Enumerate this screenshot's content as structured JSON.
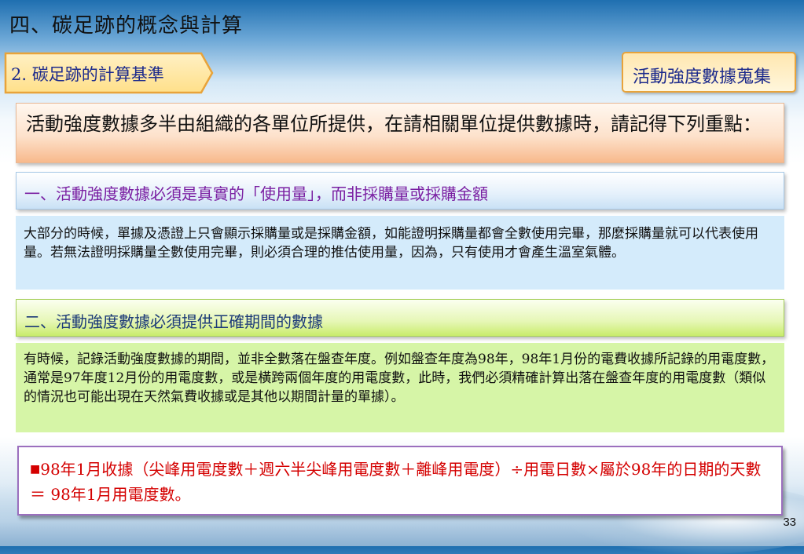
{
  "page_title": "四、碳足跡的概念與計算",
  "section_tag": "2. 碳足跡的計算基準",
  "topic_tag": "活動強度數據蒐集",
  "intro": "活動強度數據多半由組織的各單位所提供，在請相關單位提供數據時，請記得下列重點：",
  "point1": {
    "heading": "一、活動強度數據必須是真實的「使用量」，而非採購量或採購金額",
    "body": "大部分的時候，單據及憑證上只會顯示採購量或是採購金額，如能證明採購量都會全數使用完畢，那麼採購量就可以代表使用量。若無法證明採購量全數使用完畢，則必須合理的推估使用量，因為，只有使用才會產生溫室氣體。"
  },
  "point2": {
    "heading": "二、活動強度數據必須提供正確期間的數據",
    "body": "有時候，記錄活動強度數據的期間，並非全數落在盤查年度。例如盤查年度為98年，98年1月份的電費收據所記錄的用電度數，通常是97年度12月份的用電度數，或是橫跨兩個年度的用電度數，此時，我們必須精確計算出落在盤查年度的用電度數（類似的情況也可能出現在天然氣費收據或是其他以期間計量的單據）。"
  },
  "formula": {
    "bullet": "■",
    "text": "98年1月收據（尖峰用電度數＋週六半尖峰用電度數＋離峰用電度）÷用電日數×屬於98年的日期的天數 ＝ 98年1月用電度數。"
  },
  "page_number": "33",
  "colors": {
    "purple_heading": "#7a1fa2",
    "formula_red": "#d40000",
    "blue_label": "#1c2a8c"
  }
}
